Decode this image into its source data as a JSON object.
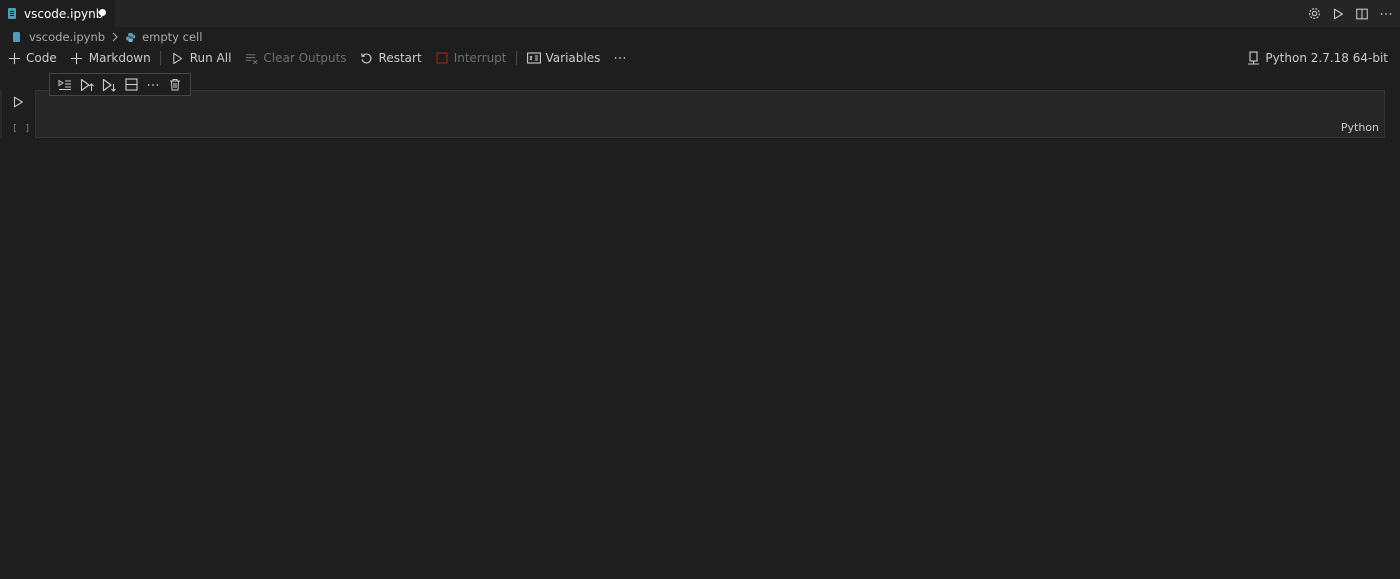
{
  "tab": {
    "label": "vscode.ipynb",
    "dirty": true
  },
  "tab_actions": [
    "gear-icon",
    "run-icon",
    "split-editor-icon",
    "more-icon"
  ],
  "breadcrumb": {
    "file": "vscode.ipynb",
    "cell": "empty cell"
  },
  "toolbar": {
    "add_code": "Code",
    "add_markdown": "Markdown",
    "run_all": "Run All",
    "clear_outputs": "Clear Outputs",
    "restart": "Restart",
    "interrupt": "Interrupt",
    "variables": "Variables"
  },
  "kernel": {
    "label": "Python 2.7.18 64-bit"
  },
  "cell": {
    "execution_count": "[ ]",
    "language": "Python",
    "toolbar_icons": [
      "execute-above-icon",
      "run-above-icon",
      "run-below-icon",
      "split-cell-icon",
      "more-icon",
      "delete-icon"
    ]
  },
  "colors": {
    "accent": "#519aba",
    "background": "#1e1e1e",
    "tab_bar": "#252526"
  }
}
